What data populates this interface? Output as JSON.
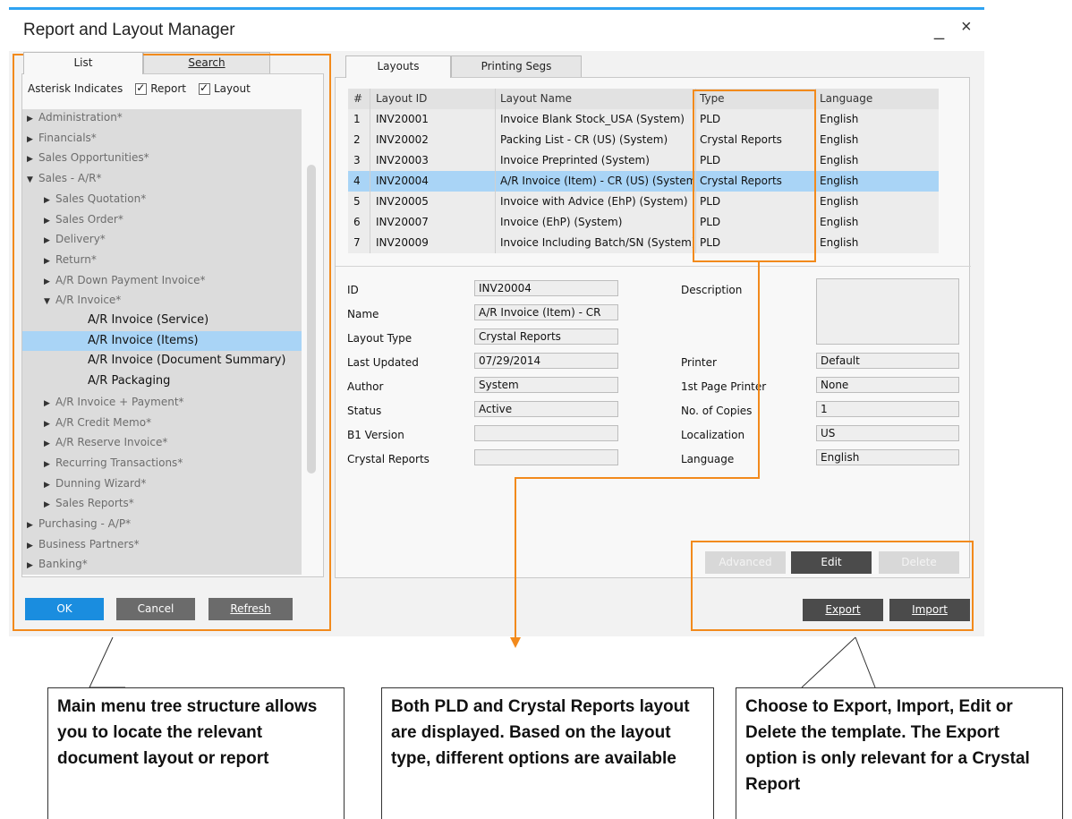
{
  "window": {
    "title": "Report and Layout Manager",
    "minimize": "_",
    "close": "×"
  },
  "left": {
    "tabs": [
      "List",
      "Search"
    ],
    "asterisk_label": "Asterisk Indicates",
    "report_label": "Report",
    "layout_label": "Layout",
    "tree": [
      {
        "arrow": "▶",
        "label": "Administration*"
      },
      {
        "arrow": "▶",
        "label": "Financials*"
      },
      {
        "arrow": "▶",
        "label": "Sales Opportunities*"
      },
      {
        "arrow": "▼",
        "label": "Sales - A/R*"
      },
      {
        "arrow": "▶",
        "label": "Sales Quotation*"
      },
      {
        "arrow": "▶",
        "label": "Sales Order*"
      },
      {
        "arrow": "▶",
        "label": "Delivery*"
      },
      {
        "arrow": "▶",
        "label": "Return*"
      },
      {
        "arrow": "▶",
        "label": "A/R Down Payment Invoice*"
      },
      {
        "arrow": "▼",
        "label": "A/R Invoice*"
      },
      {
        "arrow": "",
        "label": "A/R Invoice (Service)"
      },
      {
        "arrow": "",
        "label": "A/R Invoice (Items)"
      },
      {
        "arrow": "",
        "label": "A/R Invoice (Document Summary)"
      },
      {
        "arrow": "",
        "label": "A/R Packaging"
      },
      {
        "arrow": "▶",
        "label": "A/R Invoice + Payment*"
      },
      {
        "arrow": "▶",
        "label": "A/R Credit Memo*"
      },
      {
        "arrow": "▶",
        "label": "A/R Reserve Invoice*"
      },
      {
        "arrow": "▶",
        "label": "Recurring Transactions*"
      },
      {
        "arrow": "▶",
        "label": "Dunning Wizard*"
      },
      {
        "arrow": "▶",
        "label": "Sales Reports*"
      },
      {
        "arrow": "▶",
        "label": "Purchasing - A/P*"
      },
      {
        "arrow": "▶",
        "label": "Business Partners*"
      },
      {
        "arrow": "▶",
        "label": "Banking*"
      }
    ],
    "buttons": {
      "ok": "OK",
      "cancel": "Cancel",
      "refresh": "Refresh"
    }
  },
  "right": {
    "tabs": [
      "Layouts",
      "Printing Segs"
    ],
    "grid": {
      "headers": [
        "#",
        "Layout ID",
        "Layout Name",
        "Type",
        "Language"
      ],
      "rows": [
        [
          "1",
          "INV20001",
          "Invoice Blank Stock_USA (System)",
          "PLD",
          "English"
        ],
        [
          "2",
          "INV20002",
          "Packing List - CR (US) (System)",
          "Crystal Reports",
          "English"
        ],
        [
          "3",
          "INV20003",
          "Invoice Preprinted (System)",
          "PLD",
          "English"
        ],
        [
          "4",
          "INV20004",
          "A/R Invoice (Item) - CR (US) (System)",
          "Crystal Reports",
          "English"
        ],
        [
          "5",
          "INV20005",
          "Invoice with Advice (EhP) (System)",
          "PLD",
          "English"
        ],
        [
          "6",
          "INV20007",
          "Invoice (EhP) (System)",
          "PLD",
          "English"
        ],
        [
          "7",
          "INV20009",
          "Invoice Including Batch/SN (System)",
          "PLD",
          "English"
        ]
      ]
    },
    "details": {
      "id_label": "ID",
      "id": "INV20004",
      "name_label": "Name",
      "name": "A/R Invoice (Item) - CR",
      "type_label": "Layout Type",
      "type": "Crystal Reports",
      "updated_label": "Last Updated",
      "updated": "07/29/2014",
      "author_label": "Author",
      "author": "System",
      "status_label": "Status",
      "status": "Active",
      "b1_label": "B1 Version",
      "b1": "",
      "cr_label": "Crystal Reports",
      "cr": "",
      "description_label": "Description",
      "description": "",
      "printer_label": "Printer",
      "printer": "Default",
      "first_printer_label": "1st Page Printer",
      "first_printer": "None",
      "copies_label": "No. of Copies",
      "copies": "1",
      "localization_label": "Localization",
      "localization": "US",
      "language_label": "Language",
      "language": "English"
    },
    "buttons": {
      "advanced": "Advanced",
      "edit": "Edit",
      "delete": "Delete",
      "export": "Export",
      "import": "Import"
    }
  },
  "callouts": {
    "left": "Main menu tree structure allows you to locate the relevant document layout or report",
    "middle": "Both PLD and Crystal Reports layout are displayed. Based on the layout type, different options are available",
    "right": "Choose to Export, Import, Edit or Delete the template. The Export option is only relevant for a Crystal Report"
  },
  "colors": {
    "accent": "#1a8ddf",
    "annotation": "#f28a1c",
    "selection": "#a9d4f6"
  }
}
